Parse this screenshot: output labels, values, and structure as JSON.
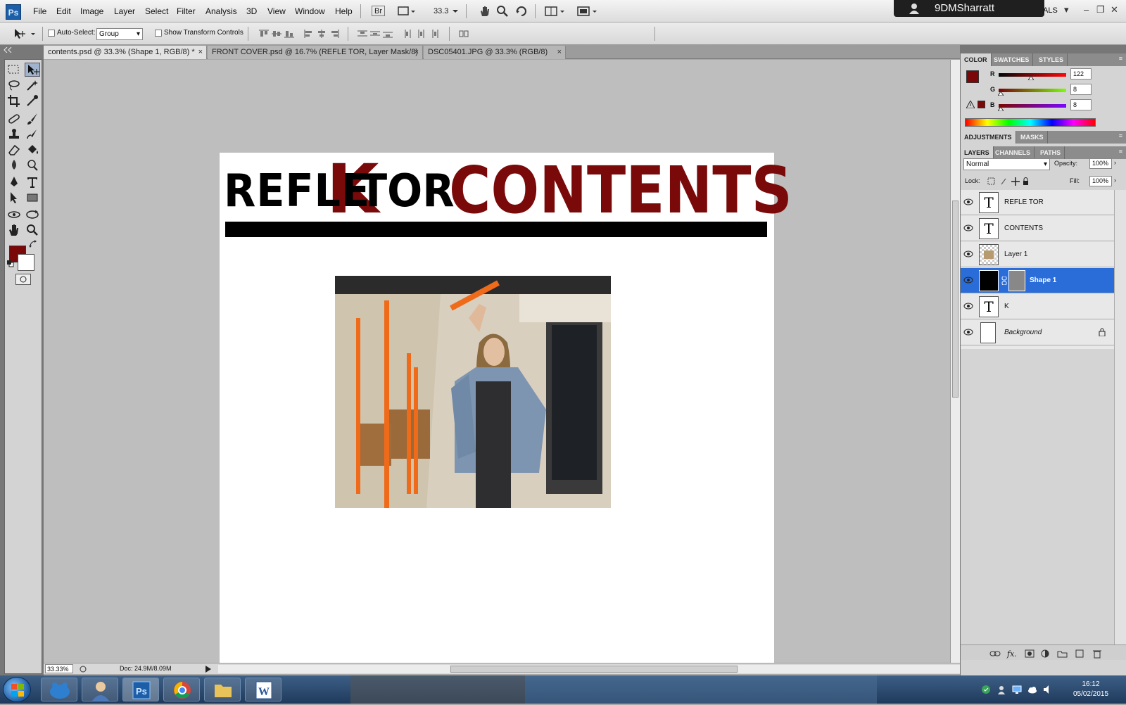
{
  "app": {
    "logo": "Ps"
  },
  "menubar": {
    "items": [
      "File",
      "Edit",
      "Image",
      "Layer",
      "Select",
      "Filter",
      "Analysis",
      "3D",
      "View",
      "Window",
      "Help"
    ],
    "bridge": "Br",
    "zoom": "33.3",
    "workspace": "ALS",
    "user": "9DMSharratt"
  },
  "options": {
    "auto_select_label": "Auto-Select:",
    "auto_select_value": "Group",
    "show_transform_label": "Show Transform Controls"
  },
  "tabs": [
    {
      "label": "contents.psd @ 33.3% (Shape 1, RGB/8) *",
      "close": "×"
    },
    {
      "label": "FRONT COVER.psd @ 16.7% (REFLE    TOR, Layer Mask/8)",
      "close": "×"
    },
    {
      "label": "DSC05401.JPG @ 33.3% (RGB/8)",
      "close": "×"
    }
  ],
  "document": {
    "title_left": "REFLE",
    "title_k": "K",
    "title_tor": "TOR",
    "title_right": "CONTENTS",
    "colors": {
      "maroon": "#7a0a0a",
      "black": "#000000"
    }
  },
  "status": {
    "zoom": "33.33%",
    "doc_info": "Doc: 24.9M/8.09M"
  },
  "color_panel": {
    "tabs": [
      "COLOR",
      "SWATCHES",
      "STYLES"
    ],
    "r_label": "R",
    "g_label": "G",
    "b_label": "B",
    "r": "122",
    "g": "8",
    "b": "8",
    "r_level": 0.48,
    "g_level": 0.03,
    "b_level": 0.03,
    "foreground": "#7a0808"
  },
  "adjust_panel": {
    "tabs": [
      "ADJUSTMENTS",
      "MASKS"
    ]
  },
  "layers_panel": {
    "tabs": [
      "LAYERS",
      "CHANNELS",
      "PATHS"
    ],
    "blend_mode": "Normal",
    "opacity_label": "Opacity:",
    "opacity": "100%",
    "lock_label": "Lock:",
    "fill_label": "Fill:",
    "fill": "100%",
    "layers": [
      {
        "name": "REFLE  TOR",
        "thumb": "T"
      },
      {
        "name": "CONTENTS",
        "thumb": "T"
      },
      {
        "name": "Layer 1",
        "thumb": ""
      },
      {
        "name": "Shape 1",
        "thumb": ""
      },
      {
        "name": "K",
        "thumb": "T"
      },
      {
        "name": "Background",
        "thumb": ""
      }
    ]
  },
  "taskbar": {
    "time": "16:12",
    "date": "05/02/2015"
  }
}
